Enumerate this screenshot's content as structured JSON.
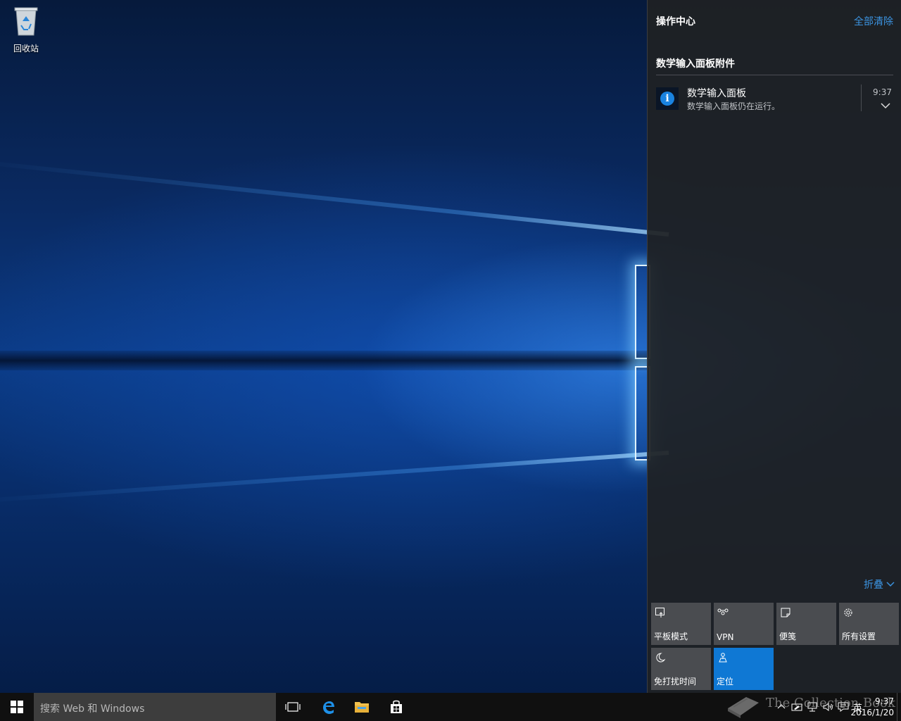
{
  "desktop": {
    "recycle_bin_label": "回收站"
  },
  "action_center": {
    "title": "操作中心",
    "clear_all": "全部清除",
    "group_title": "数学输入面板附件",
    "notification": {
      "title": "数学输入面板",
      "body": "数学输入面板仍在运行。",
      "time": "9:37"
    },
    "collapse_label": "折叠",
    "quick_actions": [
      {
        "label": "平板模式",
        "icon": "tablet-mode-icon",
        "active": false
      },
      {
        "label": "VPN",
        "icon": "vpn-icon",
        "active": false
      },
      {
        "label": "便笺",
        "icon": "note-icon",
        "active": false
      },
      {
        "label": "所有设置",
        "icon": "gear-icon",
        "active": false
      },
      {
        "label": "免打扰时间",
        "icon": "moon-icon",
        "active": false
      },
      {
        "label": "定位",
        "icon": "location-icon",
        "active": true
      }
    ],
    "accent_color": "#0f78d4",
    "link_color": "#3b93e0"
  },
  "taskbar": {
    "search_placeholder": "搜索 Web 和 Windows",
    "ime_indicator": "英",
    "clock_time": "9:37",
    "clock_date": "2016/1/20"
  },
  "watermark": {
    "text": "The Collection Book"
  }
}
